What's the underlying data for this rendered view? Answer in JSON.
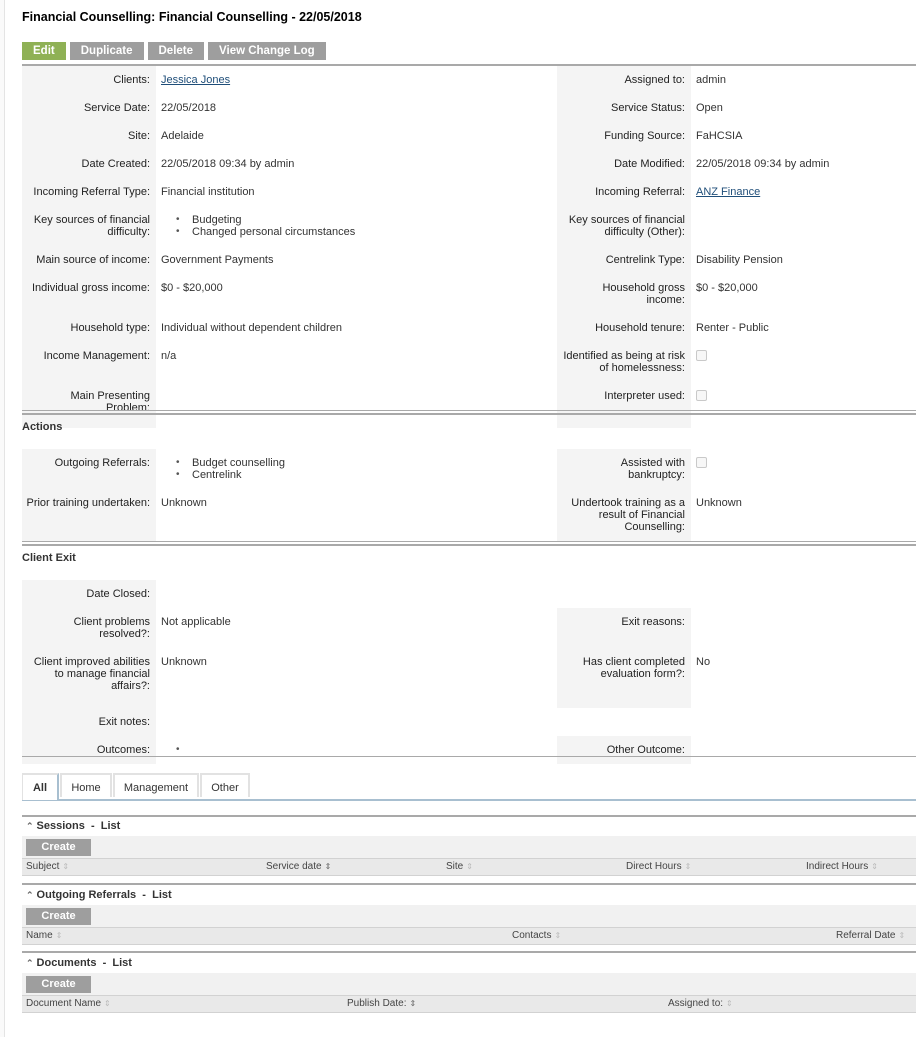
{
  "page": {
    "title": "Financial Counselling: Financial Counselling - 22/05/2018"
  },
  "toolbar": {
    "edit": "Edit",
    "duplicate": "Duplicate",
    "delete": "Delete",
    "view_change_log": "View Change Log"
  },
  "colors": {
    "edit_button": "#8fb155",
    "gray_button": "#9e9e9e",
    "link": "#1f4e79",
    "label_bg": "#f4f4f4"
  },
  "overview": {
    "clients": {
      "label": "Clients:",
      "value": "Jessica Jones"
    },
    "assigned_to": {
      "label": "Assigned to:",
      "value": "admin"
    },
    "service_date": {
      "label": "Service Date:",
      "value": "22/05/2018"
    },
    "service_status": {
      "label": "Service Status:",
      "value": "Open"
    },
    "site": {
      "label": "Site:",
      "value": "Adelaide"
    },
    "funding_source": {
      "label": "Funding Source:",
      "value": "FaHCSIA"
    },
    "date_created": {
      "label": "Date Created:",
      "value": "22/05/2018 09:34 by admin"
    },
    "date_modified": {
      "label": "Date Modified:",
      "value": "22/05/2018 09:34 by admin"
    },
    "incoming_referral_type": {
      "label": "Incoming Referral Type:",
      "value": "Financial institution"
    },
    "incoming_referral": {
      "label": "Incoming Referral:",
      "value": "ANZ Finance"
    },
    "key_sources": {
      "label": "Key sources of financial difficulty:",
      "items": [
        "Budgeting",
        "Changed personal circumstances"
      ]
    },
    "key_sources_other": {
      "label": "Key sources of financial difficulty (Other):",
      "value": ""
    },
    "main_source_income": {
      "label": "Main source of income:",
      "value": "Government Payments"
    },
    "centrelink_type": {
      "label": "Centrelink Type:",
      "value": "Disability Pension"
    },
    "individual_gross_income": {
      "label": "Individual gross income:",
      "value": "$0 - $20,000"
    },
    "household_gross_income": {
      "label": "Household gross income:",
      "value": "$0 - $20,000"
    },
    "household_type": {
      "label": "Household type:",
      "value": "Individual without dependent children"
    },
    "household_tenure": {
      "label": "Household tenure:",
      "value": "Renter - Public"
    },
    "income_management": {
      "label": "Income Management:",
      "value": "n/a"
    },
    "risk_homelessness": {
      "label": "Identified as being at risk of homelessness:",
      "checked": false
    },
    "main_presenting_problem": {
      "label": "Main Presenting Problem:",
      "value": ""
    },
    "interpreter_used": {
      "label": "Interpreter used:",
      "checked": false
    }
  },
  "actions": {
    "title": "Actions",
    "outgoing_referrals": {
      "label": "Outgoing Referrals:",
      "items": [
        "Budget counselling",
        "Centrelink"
      ]
    },
    "assisted_bankruptcy": {
      "label": "Assisted with bankruptcy:",
      "checked": false
    },
    "prior_training": {
      "label": "Prior training undertaken:",
      "value": "Unknown"
    },
    "undertook_training": {
      "label": "Undertook training as a result of Financial Counselling:",
      "value": "Unknown"
    }
  },
  "client_exit": {
    "title": "Client Exit",
    "date_closed": {
      "label": "Date Closed:",
      "value": ""
    },
    "problems_resolved": {
      "label": "Client problems resolved?:",
      "value": "Not applicable"
    },
    "exit_reasons": {
      "label": "Exit reasons:",
      "value": ""
    },
    "improved_abilities": {
      "label": "Client improved abilities to manage financial affairs?:",
      "value": "Unknown"
    },
    "evaluation_form": {
      "label": "Has client completed evaluation form?:",
      "value": "No"
    },
    "exit_notes": {
      "label": "Exit notes:",
      "value": ""
    },
    "outcomes": {
      "label": "Outcomes:",
      "items": [
        ""
      ]
    },
    "other_outcome": {
      "label": "Other Outcome:",
      "value": ""
    }
  },
  "tabs": [
    {
      "label": "All",
      "active": true
    },
    {
      "label": "Home",
      "active": false
    },
    {
      "label": "Management",
      "active": false
    },
    {
      "label": "Other",
      "active": false
    }
  ],
  "subpanels": {
    "sessions": {
      "title": "Sessions",
      "sep": "-",
      "list": "List",
      "create": "Create",
      "columns": [
        "Subject",
        "Service date",
        "Site",
        "Direct Hours",
        "Indirect Hours"
      ]
    },
    "outgoing_referrals": {
      "title": "Outgoing Referrals",
      "sep": "-",
      "list": "List",
      "create": "Create",
      "columns": [
        "Name",
        "Contacts",
        "Referral Date"
      ]
    },
    "documents": {
      "title": "Documents",
      "sep": "-",
      "list": "List",
      "create": "Create",
      "columns": [
        "Document Name",
        "Publish Date:",
        "Assigned to:"
      ]
    }
  }
}
